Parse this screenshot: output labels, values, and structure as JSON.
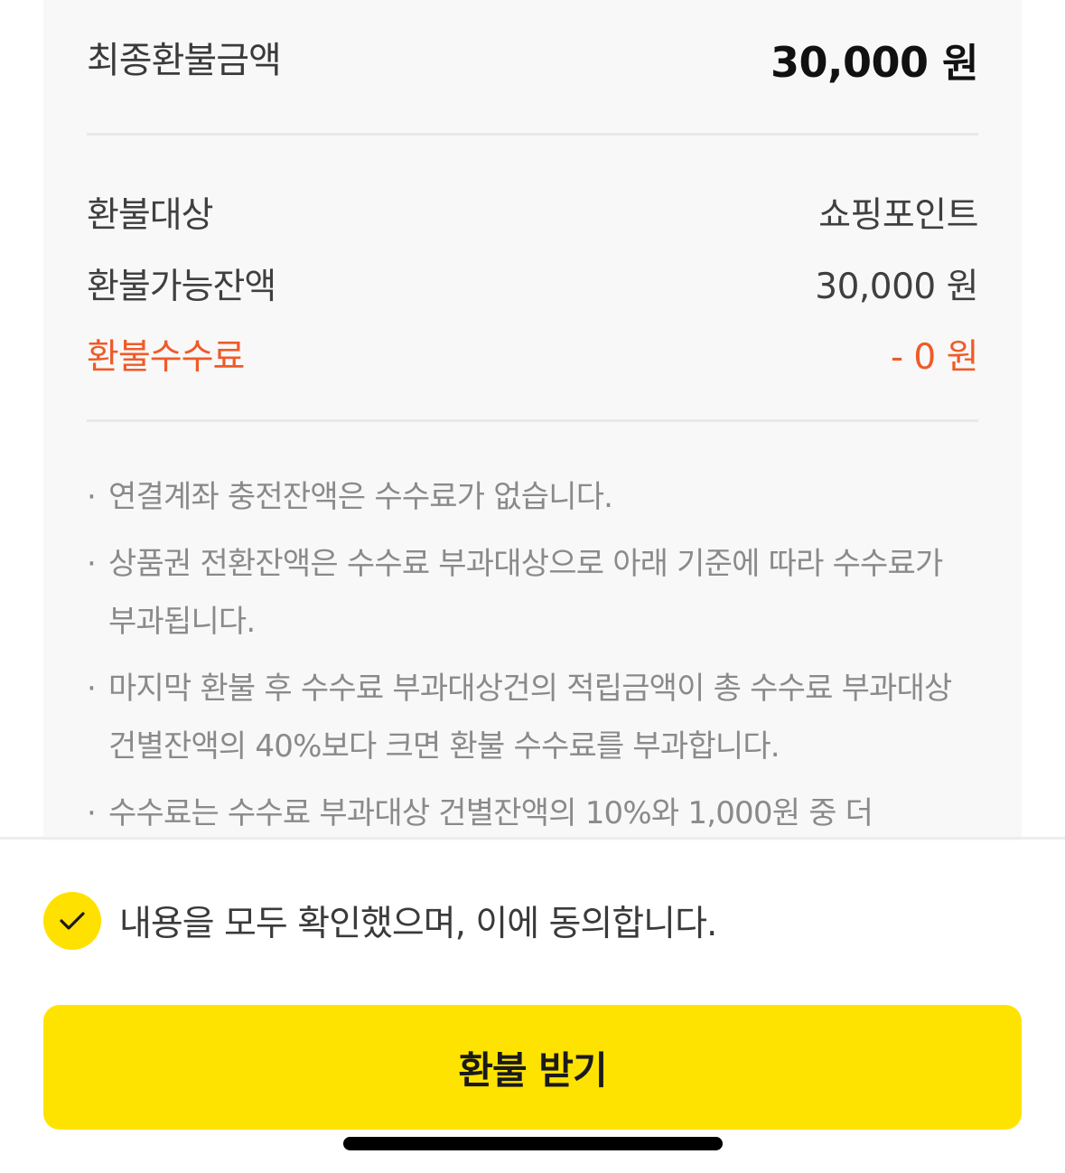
{
  "summary": {
    "final_label": "최종환불금액",
    "final_amount": "30,000",
    "final_unit": "원"
  },
  "details": {
    "target_label": "환불대상",
    "target_value": "쇼핑포인트",
    "balance_label": "환불가능잔액",
    "balance_value": "30,000 원",
    "fee_label": "환불수수료",
    "fee_value": "- 0 원",
    "fee_color": "#f05a28"
  },
  "notes": [
    {
      "bullet": "·",
      "text": "연결계좌 충전잔액은 수수료가 없습니다."
    },
    {
      "bullet": "·",
      "text": "상품권 전환잔액은 수수료 부과대상으로 아래 기준에 따라 수수료가 부과됩니다."
    },
    {
      "bullet": "·",
      "text": "마지막 환불 후 수수료 부과대상건의 적립금액이 총 수수료 부과대상 건별잔액의 40%보다 크면 환불 수수료를 부과합니다."
    },
    {
      "bullet": "·",
      "text": "수수료는 수수료 부과대상 건별잔액의 10%와 1,000원 중 더"
    }
  ],
  "agreement": {
    "checked": true,
    "icon": "check-icon",
    "text": "내용을 모두 확인했으며, 이에 동의합니다."
  },
  "action": {
    "refund_label": "환불 받기",
    "accent_color": "#ffe300"
  }
}
